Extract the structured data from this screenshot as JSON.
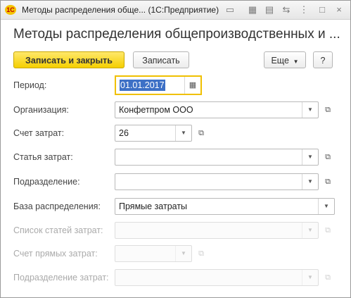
{
  "window": {
    "title": "Методы распределения обще... (1С:Предприятие)",
    "logo": "1С"
  },
  "page": {
    "title": "Методы распределения общепроизводственных и ..."
  },
  "toolbar": {
    "save_close_label": "Записать и закрыть",
    "save_label": "Записать",
    "more_label": "Еще",
    "help_label": "?"
  },
  "form": {
    "period": {
      "label": "Период:",
      "value": "01.01.2017"
    },
    "organization": {
      "label": "Организация:",
      "value": "Конфетпром ООО"
    },
    "cost_account": {
      "label": "Счет затрат:",
      "value": "26"
    },
    "cost_item": {
      "label": "Статья затрат:",
      "value": ""
    },
    "department": {
      "label": "Подразделение:",
      "value": ""
    },
    "distribution_base": {
      "label": "База распределения:",
      "value": "Прямые затраты"
    },
    "cost_items_list": {
      "label": "Список статей затрат:",
      "value": ""
    },
    "direct_cost_account": {
      "label": "Счет прямых затрат:",
      "value": ""
    },
    "cost_department": {
      "label": "Подразделение затрат:",
      "value": ""
    }
  },
  "icons": {
    "dropdown": "▼",
    "open": "⧉",
    "calendar": "▦"
  }
}
